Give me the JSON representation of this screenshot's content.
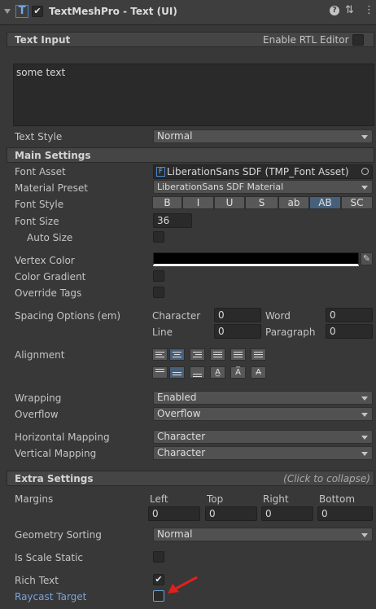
{
  "header": {
    "component_title": "TextMeshPro - Text (UI)",
    "component_icon": "T-icon"
  },
  "text_input": {
    "section_title": "Text Input",
    "rtl_label": "Enable RTL Editor",
    "text_value": "some text",
    "text_style_label": "Text Style",
    "text_style_value": "Normal"
  },
  "main_settings": {
    "section_title": "Main Settings",
    "font_asset_label": "Font Asset",
    "font_asset_value": "LiberationSans SDF (TMP_Font Asset)",
    "material_preset_label": "Material Preset",
    "material_preset_value": "LiberationSans SDF Material",
    "font_style_label": "Font Style",
    "font_style_buttons": [
      "B",
      "I",
      "U",
      "S",
      "ab",
      "AB",
      "SC"
    ],
    "font_size_label": "Font Size",
    "font_size_value": "36",
    "auto_size_label": "Auto Size",
    "vertex_color_label": "Vertex Color",
    "color_gradient_label": "Color Gradient",
    "override_tags_label": "Override Tags",
    "spacing_label": "Spacing Options (em)",
    "character_label": "Character",
    "character_value": "0",
    "word_label": "Word",
    "word_value": "0",
    "line_label": "Line",
    "line_value": "0",
    "paragraph_label": "Paragraph",
    "paragraph_value": "0",
    "alignment_label": "Alignment",
    "wrapping_label": "Wrapping",
    "wrapping_value": "Enabled",
    "overflow_label": "Overflow",
    "overflow_value": "Overflow",
    "h_mapping_label": "Horizontal Mapping",
    "h_mapping_value": "Character",
    "v_mapping_label": "Vertical Mapping",
    "v_mapping_value": "Character"
  },
  "extra_settings": {
    "section_title": "Extra Settings",
    "collapse_hint": "(Click to collapse)",
    "margins_label": "Margins",
    "left_label": "Left",
    "left_value": "0",
    "top_label": "Top",
    "top_value": "0",
    "right_label": "Right",
    "right_value": "0",
    "bottom_label": "Bottom",
    "bottom_value": "0",
    "geometry_sorting_label": "Geometry Sorting",
    "geometry_sorting_value": "Normal",
    "is_scale_static_label": "Is Scale Static",
    "rich_text_label": "Rich Text",
    "raycast_target_label": "Raycast Target"
  },
  "colors": {
    "background": "#383838",
    "accent_blue": "#46607c",
    "highlight_label": "#7aa3d8",
    "annotation_arrow": "#e0201c",
    "vertex_color": "#000000"
  }
}
